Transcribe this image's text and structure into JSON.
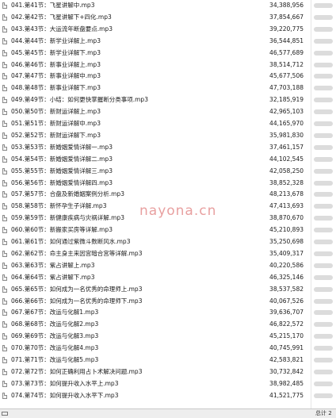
{
  "files": [
    {
      "name": "041.第41节：飞星讲解中.mp3",
      "size": "34,388,956"
    },
    {
      "name": "042.第42节：飞星讲解下+四化.mp3",
      "size": "37,854,667"
    },
    {
      "name": "043.第43节：大运流年断盘要点.mp3",
      "size": "39,220,775"
    },
    {
      "name": "044.第44节：新学业详解上.mp3",
      "size": "36,544,851"
    },
    {
      "name": "045.第45节：新学业详解下.mp3",
      "size": "46,577,689"
    },
    {
      "name": "046.第46节：新事业详解上.mp3",
      "size": "38,514,712"
    },
    {
      "name": "047.第47节：新事业详解中.mp3",
      "size": "45,677,506"
    },
    {
      "name": "048.第48节：新事业详解下.mp3",
      "size": "47,703,188"
    },
    {
      "name": "049.第49节：小结：如何更快掌握断分类事项.mp3",
      "size": "32,185,919"
    },
    {
      "name": "050.第50节：新财运详解上.mp3",
      "size": "42,965,103"
    },
    {
      "name": "051.第51节：新财运详解中.mp3",
      "size": "44,165,970"
    },
    {
      "name": "052.第52节：新财运详解下.mp3",
      "size": "35,981,830"
    },
    {
      "name": "053.第53节：新婚姻爱情详解一.mp3",
      "size": "37,461,157"
    },
    {
      "name": "054.第54节：新婚姻爱情详解二.mp3",
      "size": "44,102,545"
    },
    {
      "name": "055.第55节：新婚姻爱情详解三.mp3",
      "size": "42,058,250"
    },
    {
      "name": "056.第56节：新婚姻爱情详解四.mp3",
      "size": "38,852,328"
    },
    {
      "name": "057.第57节：合盘及新婚姻案例分析.mp3",
      "size": "48,213,678"
    },
    {
      "name": "058.第58节：新怀孕生子详解.mp3",
      "size": "47,413,693"
    },
    {
      "name": "059.第59节：新健康疾病与灾祸详解.mp3",
      "size": "38,870,670"
    },
    {
      "name": "060.第60节：新搬家买房等详解.mp3",
      "size": "45,210,893"
    },
    {
      "name": "061.第61节：如何通过紫微斗数断风水.mp3",
      "size": "35,250,698"
    },
    {
      "name": "062.第62节：命主身主来因宫暗合宫等详解.mp3",
      "size": "35,409,317"
    },
    {
      "name": "063.第63节：紫占讲解上.mp3",
      "size": "40,220,586"
    },
    {
      "name": "064.第64节：紫占讲解下.mp3",
      "size": "46,325,146"
    },
    {
      "name": "065.第65节：如何成为一名优秀的命理师上.mp3",
      "size": "38,537,582"
    },
    {
      "name": "066.第66节：如何成为一名优秀的命理师下.mp3",
      "size": "40,067,526"
    },
    {
      "name": "067.第67节：改运与化解1.mp3",
      "size": "39,636,707"
    },
    {
      "name": "068.第68节：改运与化解2.mp3",
      "size": "46,822,572"
    },
    {
      "name": "069.第69节：改运与化解3.mp3",
      "size": "45,215,170"
    },
    {
      "name": "070.第70节：改运与化解4.mp3",
      "size": "40,745,991"
    },
    {
      "name": "071.第71节：改运与化解5.mp3",
      "size": "42,583,821"
    },
    {
      "name": "072.第72节：如何正确利用占卜术解决问题.mp3",
      "size": "30,732,842"
    },
    {
      "name": "073.第73节：如何提升收入水平上.mp3",
      "size": "38,982,485"
    },
    {
      "name": "074.第74节：如何提升收入水平下.mp3",
      "size": "41,521,775"
    }
  ],
  "watermark": "nayona.cn",
  "status": {
    "text": "总计 2"
  },
  "icons": {
    "file": "audio-file-icon"
  },
  "colors": {
    "background": "#ffffff",
    "watermark": "#e8a0a0",
    "status_bar": "#eeeeee"
  }
}
